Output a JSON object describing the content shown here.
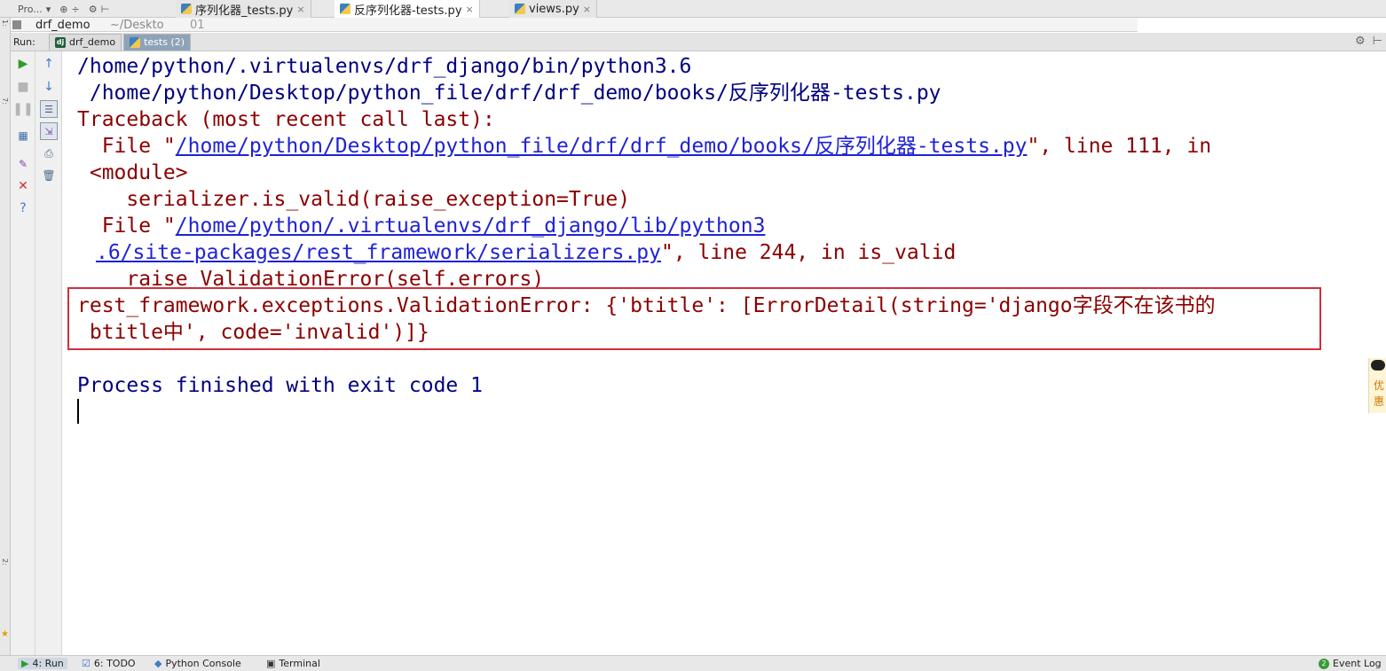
{
  "top_tabs": {
    "project": "Pro...",
    "tabs": [
      {
        "label": "序列化器_tests.py",
        "close": "×"
      },
      {
        "label": "反序列化器-tests.py",
        "close": "×"
      },
      {
        "label": "views.py",
        "close": "×"
      }
    ]
  },
  "project_strip": {
    "name": "drf_demo",
    "path": "~/Deskto",
    "line_no": "01"
  },
  "run_panel": {
    "label": "Run:",
    "tabs": [
      {
        "label": "drf_demo"
      },
      {
        "label": "tests (2)"
      }
    ]
  },
  "console": {
    "lines": [
      {
        "text": "/home/python/.virtualenvs/drf_django/bin/python3.6"
      },
      {
        "text": " /home/python/Desktop/python_file/drf/drf_demo/books/反序列化器-tests.py"
      },
      {
        "text": "Traceback (most recent call last):"
      },
      {
        "pre": "  File \"",
        "link": "/home/python/Desktop/python_file/drf/drf_demo/books/反序列化器-tests.py",
        "post": "\", line 111, in"
      },
      {
        "text": " <module>"
      },
      {
        "text": "    serializer.is_valid(raise_exception=True)"
      },
      {
        "pre": "  File \"",
        "link": "/home/python/.virtualenvs/drf_django/lib/python3"
      },
      {
        "link": ".6/site-packages/rest_framework/serializers.py",
        "post": "\", line 244, in is_valid"
      },
      {
        "text": "    raise ValidationError(self.errors)"
      },
      {
        "text": "rest_framework.exceptions.ValidationError: {'btitle': [ErrorDetail(string='django字段不在该书的"
      },
      {
        "text": " btitle中', code='invalid')]}"
      },
      {
        "text": "Process finished with exit code 1"
      }
    ]
  },
  "bottom_bar": {
    "items": [
      {
        "label": "4: Run"
      },
      {
        "label": "6: TODO"
      },
      {
        "label": "Python Console"
      },
      {
        "label": "Terminal"
      }
    ],
    "event_log": "Event Log",
    "event_count": "2"
  },
  "right_widget": {
    "line1": "优",
    "line2": "惠"
  },
  "colors": {
    "console_text": "#000080",
    "error_text": "#8b0000",
    "link": "#1f22d6",
    "highlight_box": "#d0303a"
  }
}
